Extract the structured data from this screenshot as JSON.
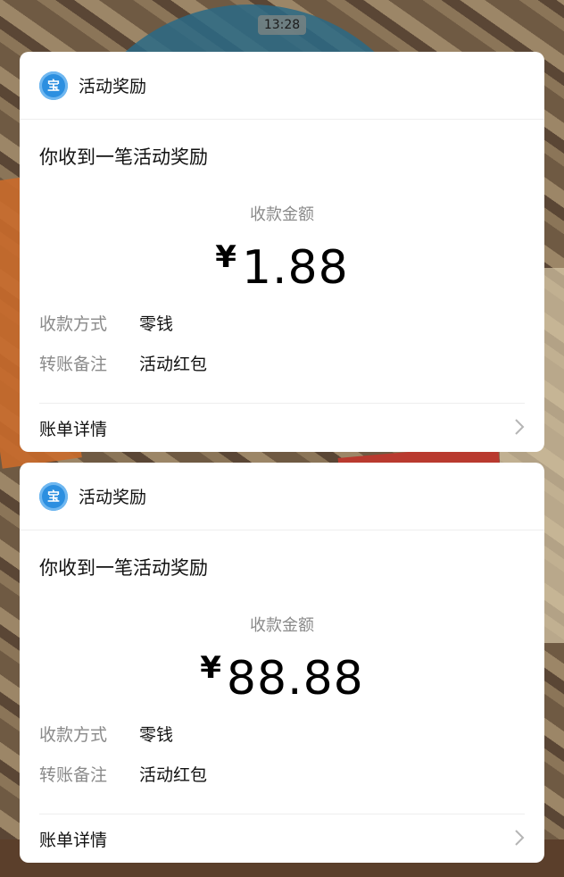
{
  "status_bar": {
    "time": "13:28"
  },
  "cards": [
    {
      "app_name": "活动奖励",
      "logo_text": "宝",
      "subtitle": "你收到一笔活动奖励",
      "amount_label": "收款金额",
      "currency_symbol": "¥",
      "amount": "1.88",
      "method_label": "收款方式",
      "method_value": "零钱",
      "note_label": "转账备注",
      "note_value": "活动红包",
      "details_label": "账单详情"
    },
    {
      "app_name": "活动奖励",
      "logo_text": "宝",
      "subtitle": "你收到一笔活动奖励",
      "amount_label": "收款金额",
      "currency_symbol": "¥",
      "amount": "88.88",
      "method_label": "收款方式",
      "method_value": "零钱",
      "note_label": "转账备注",
      "note_value": "活动红包",
      "details_label": "账单详情"
    }
  ],
  "icons": {
    "logo": "wallet-logo-icon",
    "chevron": "chevron-right-icon"
  },
  "colors": {
    "logo_blue": "#2c8fe0",
    "label_gray": "#8a8a8a",
    "card_bg": "#ffffff"
  }
}
